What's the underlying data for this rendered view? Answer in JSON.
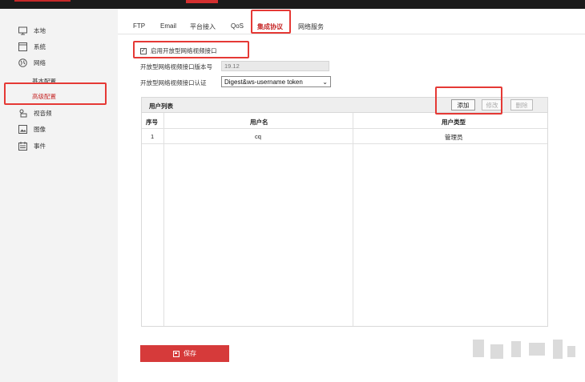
{
  "sidebar": {
    "items": [
      {
        "label": "本地",
        "icon": "monitor-icon"
      },
      {
        "label": "系统",
        "icon": "system-window-icon"
      },
      {
        "label": "网络",
        "icon": "globe-icon"
      },
      {
        "label": "视音频",
        "icon": "audio-video-icon"
      },
      {
        "label": "图像",
        "icon": "image-icon"
      },
      {
        "label": "事件",
        "icon": "calendar-icon"
      }
    ],
    "subitems": [
      {
        "label": "基本配置"
      },
      {
        "label": "高级配置"
      }
    ]
  },
  "tabs": [
    {
      "label": "FTP"
    },
    {
      "label": "Email"
    },
    {
      "label": "平台接入"
    },
    {
      "label": "QoS"
    },
    {
      "label": "集成协议"
    },
    {
      "label": "网络服务"
    }
  ],
  "form": {
    "enable_label": "启用开放型网络视频接口",
    "enable_checked": true,
    "version_label": "开放型网络视频接口版本号",
    "version_value": "19.12",
    "auth_label": "开放型网络视频接口认证",
    "auth_value": "Digest&ws-username token"
  },
  "user_list": {
    "title": "用户列表",
    "buttons": {
      "add": "添加",
      "modify": "修改",
      "delete": "删除"
    },
    "columns": [
      "序号",
      "用户名",
      "用户类型"
    ],
    "rows": [
      {
        "no": "1",
        "username": "cq",
        "type": "管理员"
      }
    ]
  },
  "save_label": "保存",
  "colors": {
    "accent": "#c62828",
    "highlight_box": "#e53935",
    "save_button": "#d63a3a"
  }
}
